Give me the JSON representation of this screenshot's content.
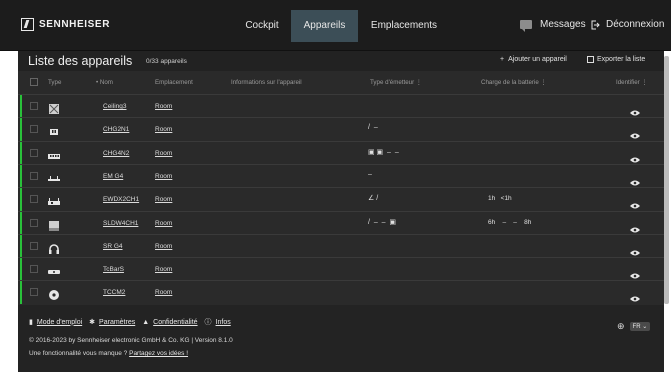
{
  "brand": {
    "name": "SENNHEISER"
  },
  "nav": {
    "tabs": [
      {
        "label": "Cockpit"
      },
      {
        "label": "Appareils"
      },
      {
        "label": "Emplacements"
      }
    ],
    "active_tab": "Appareils",
    "messages_label": "Messages",
    "logout_label": "Déconnexion"
  },
  "panel": {
    "title": "Liste des appareils",
    "count": "0/33 appareils",
    "add_label": "Ajouter un appareil",
    "export_label": "Exporter la liste"
  },
  "columns": {
    "type": "Type",
    "name": "• Nom",
    "location": "Emplacement",
    "info": "Informations sur l'appareil",
    "transmitter": "Type d'émetteur",
    "battery": "Charge de la batterie",
    "identify": "Identifier"
  },
  "devices": [
    {
      "type_icon": "ceiling-mic-icon",
      "name": "Ceiling3",
      "location": "Room",
      "transmitter": "",
      "battery": ""
    },
    {
      "type_icon": "charger-2-icon",
      "name": "CHG2N1",
      "location": "Room",
      "transmitter": "/  –",
      "battery": ""
    },
    {
      "type_icon": "charger-4-icon",
      "name": "CHG4N2",
      "location": "Room",
      "transmitter": "▣ ▣  –  –",
      "battery": ""
    },
    {
      "type_icon": "em-receiver-icon",
      "name": "EM G4",
      "location": "Room",
      "transmitter": "–",
      "battery": ""
    },
    {
      "type_icon": "ewdx-receiver-icon",
      "name": "EWDX2CH1",
      "location": "Room",
      "transmitter": "∠ /",
      "battery": "1h   <1h"
    },
    {
      "type_icon": "slot-receiver-icon",
      "name": "SLDW4CH1",
      "location": "Room",
      "transmitter": "/  –  –  ▣",
      "battery": "6h    –    –    8h"
    },
    {
      "type_icon": "headphones-icon",
      "name": "SR G4",
      "location": "Room",
      "transmitter": "",
      "battery": ""
    },
    {
      "type_icon": "soundbar-icon",
      "name": "TcBarS",
      "location": "Room",
      "transmitter": "",
      "battery": ""
    },
    {
      "type_icon": "table-mic-icon",
      "name": "TCCM2",
      "location": "Room",
      "transmitter": "",
      "battery": ""
    }
  ],
  "footer": {
    "links": [
      {
        "label": "Mode d'emploi",
        "icon": "book-icon"
      },
      {
        "label": "Paramètres",
        "icon": "gear-icon"
      },
      {
        "label": "Confidentialité",
        "icon": "person-icon"
      },
      {
        "label": "Infos",
        "icon": "info-icon"
      }
    ],
    "copyright": "© 2016-2023 by Sennheiser electronic GmbH & Co. KG | Version 8.1.0",
    "idea_prefix": "Une fonctionnalité vous manque ?",
    "idea_link": "Partagez vos idées !",
    "language": "FR"
  },
  "colors": {
    "accent_green": "#29c23a",
    "active_tab": "#3c4e57",
    "panel_bg": "#2a2a2a"
  }
}
